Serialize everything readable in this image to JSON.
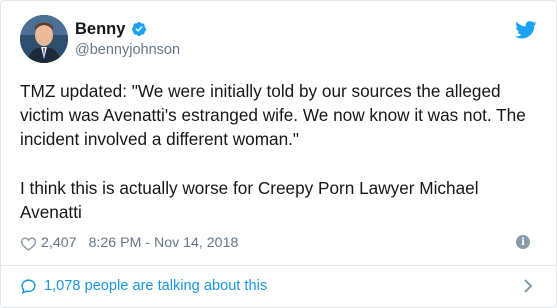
{
  "author": {
    "display_name": "Benny",
    "handle": "@bennyjohnson",
    "verified": true
  },
  "icons": {
    "avatar": "avatar",
    "verified": "verified-badge-icon",
    "platform": "twitter-bird-icon",
    "like": "heart-icon",
    "info": "info-icon",
    "conversation": "speech-bubble-icon",
    "navigate": "chevron-right-icon"
  },
  "tweet": {
    "paragraph_1": "TMZ updated: \"We were initially told by our sources the alleged victim was Avenatti's estranged wife. We now know it was not. The incident involved a different woman.\"",
    "paragraph_2": "I think this is actually worse for Creepy Porn Lawyer Michael Avenatti"
  },
  "meta": {
    "likes": "2,407",
    "timestamp": "8:26 PM - Nov 14, 2018"
  },
  "conversation": {
    "label": "1,078 people are talking about this"
  },
  "colors": {
    "text": "#14171a",
    "secondary": "#657786",
    "accent": "#1b95e0",
    "verified": "#1da1f2",
    "border": "#e1e8ed"
  }
}
